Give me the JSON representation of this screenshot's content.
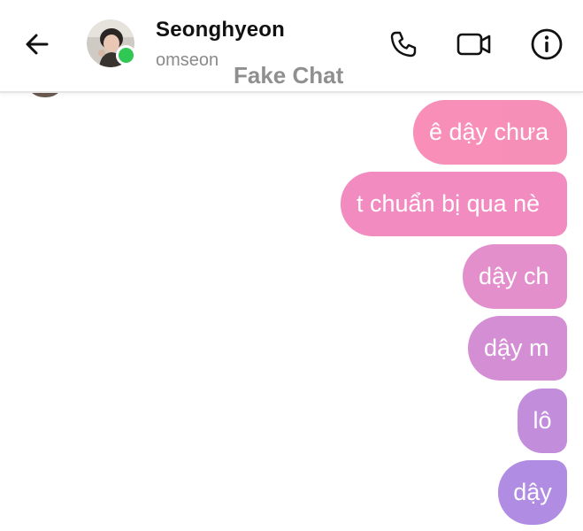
{
  "header": {
    "contact_name": "Seonghyeon",
    "contact_subtitle": "omseon",
    "watermark": "Fake Chat",
    "online_color": "#31c754",
    "icons": {
      "back": "arrow-left-icon",
      "call": "phone-icon",
      "video": "video-camera-icon",
      "info": "info-icon"
    }
  },
  "messages": [
    {
      "text": "ê dậy chưa",
      "sender": "me",
      "color": "#f98fb9"
    },
    {
      "text": "t chuẩn bị qua nè",
      "sender": "me",
      "color": "#f18bc0"
    },
    {
      "text": "dậy ch",
      "sender": "me",
      "color": "#e28fcb"
    },
    {
      "text": "dậy m",
      "sender": "me",
      "color": "#d38ed4"
    },
    {
      "text": "lô",
      "sender": "me",
      "color": "#c28ddb"
    },
    {
      "text": "dậy",
      "sender": "me",
      "color": "#b18ce3"
    }
  ]
}
